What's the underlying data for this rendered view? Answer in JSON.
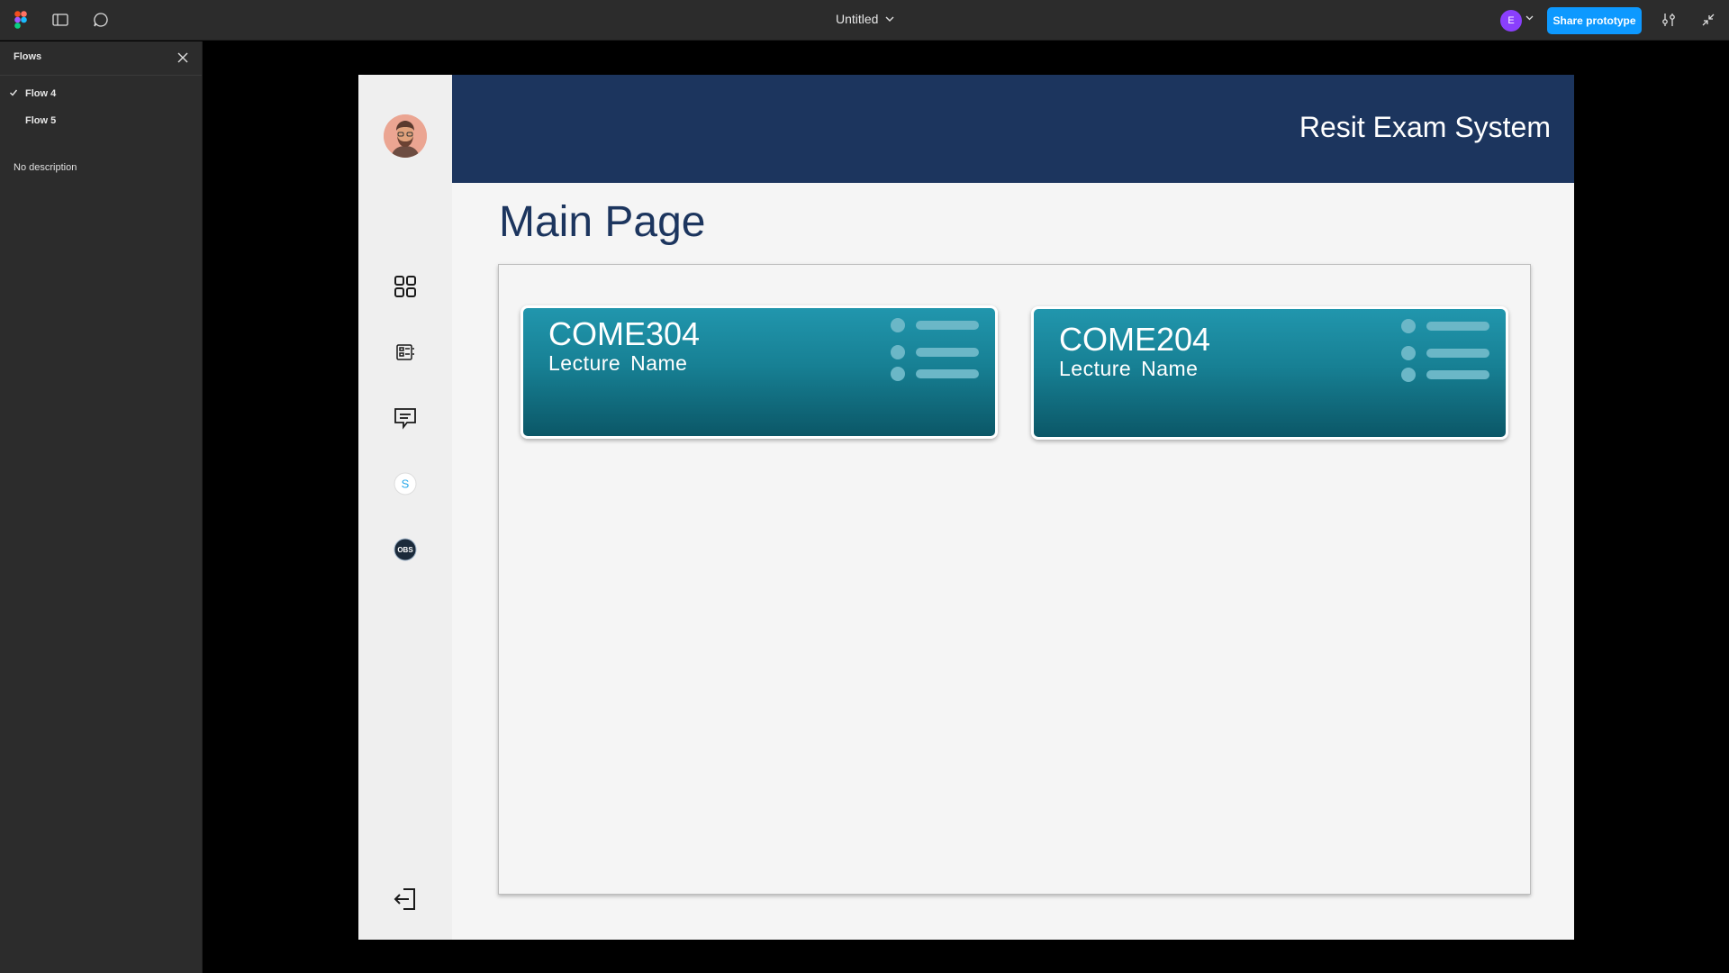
{
  "topbar": {
    "file_title": "Untitled",
    "user_initial": "E",
    "share_label": "Share prototype",
    "icons": [
      "figma-logo-icon",
      "sidebar-toggle-icon",
      "comment-icon",
      "chevron-down-icon",
      "settings-sliders-icon",
      "collapse-icon"
    ]
  },
  "flows_panel": {
    "title": "Flows",
    "items": [
      {
        "label": "Flow 4",
        "selected": true
      },
      {
        "label": "Flow 5",
        "selected": false
      }
    ],
    "description": "No description"
  },
  "app": {
    "title": "Resit Exam System",
    "page_title": "Main Page",
    "nav_icons": [
      "dashboard-grid-icon",
      "exam-list-icon",
      "messages-icon",
      "skype-icon",
      "obs-icon",
      "logout-icon"
    ],
    "courses": [
      {
        "code": "COME304",
        "name": "Lecture  Name"
      },
      {
        "code": "COME204",
        "name": "Lecture  Name"
      }
    ]
  },
  "colors": {
    "header": "#1c355e",
    "accent": "#0d99ff",
    "card_top": "#2196ad",
    "card_bottom": "#0b5767"
  }
}
